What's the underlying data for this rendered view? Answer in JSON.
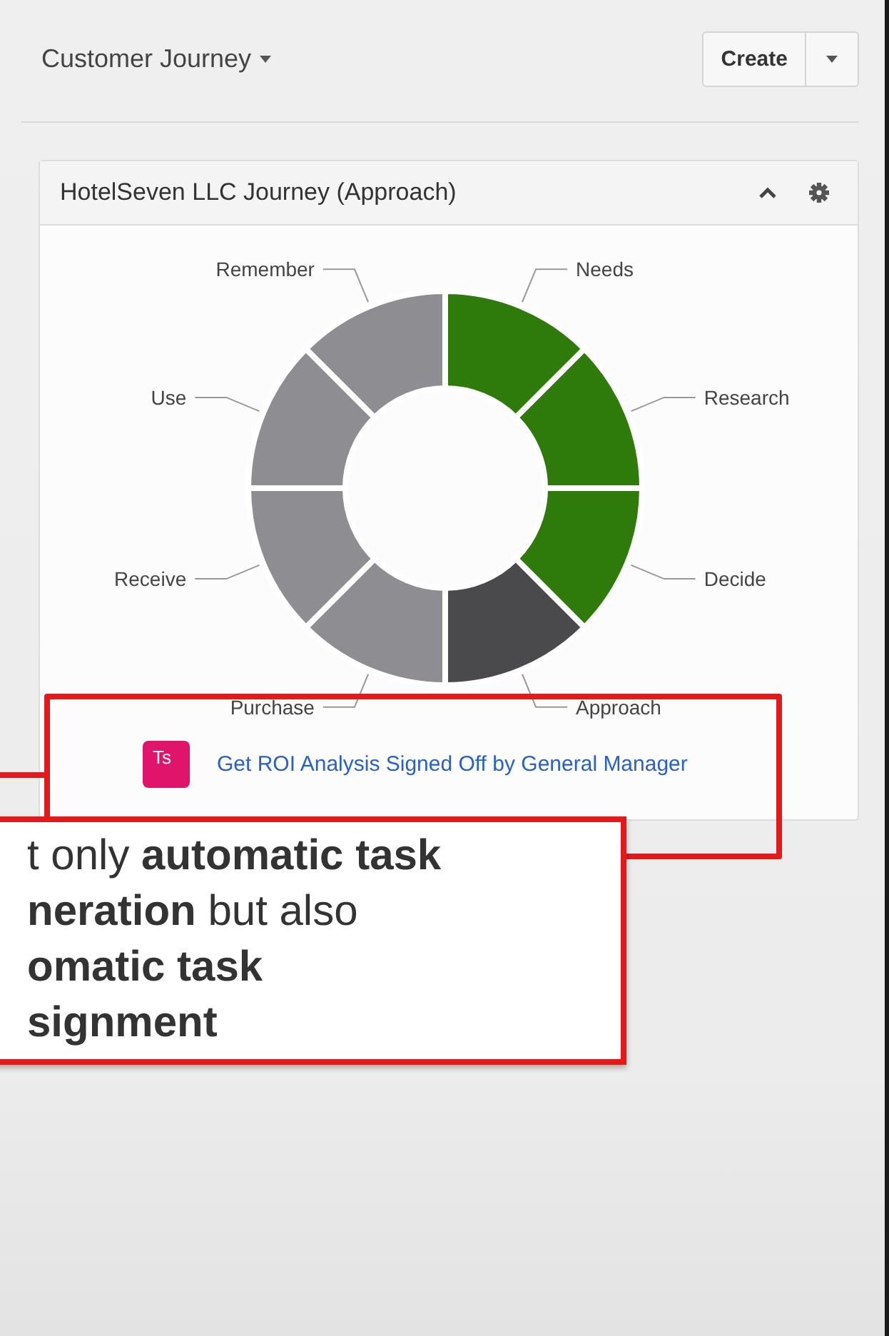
{
  "header": {
    "title": "Customer Journey",
    "create_button": "Create"
  },
  "card": {
    "title": "HotelSeven LLC Journey (Approach)",
    "stages": [
      {
        "name": "Needs",
        "color": "#2e7b0b"
      },
      {
        "name": "Research",
        "color": "#2e7b0b"
      },
      {
        "name": "Decide",
        "color": "#2e7b0b"
      },
      {
        "name": "Approach",
        "color": "#4a4a4d"
      },
      {
        "name": "Purchase",
        "color": "#8e8d91"
      },
      {
        "name": "Receive",
        "color": "#8e8d91"
      },
      {
        "name": "Use",
        "color": "#8e8d91"
      },
      {
        "name": "Remember",
        "color": "#8e8d91"
      }
    ],
    "task": {
      "badge": "Ts",
      "link": "Get ROI Analysis Signed Off by General Manager"
    }
  },
  "callout": {
    "lines": [
      "t only **automatic task**",
      "**neration** but also",
      "**omatic task**",
      "**signment**"
    ]
  }
}
